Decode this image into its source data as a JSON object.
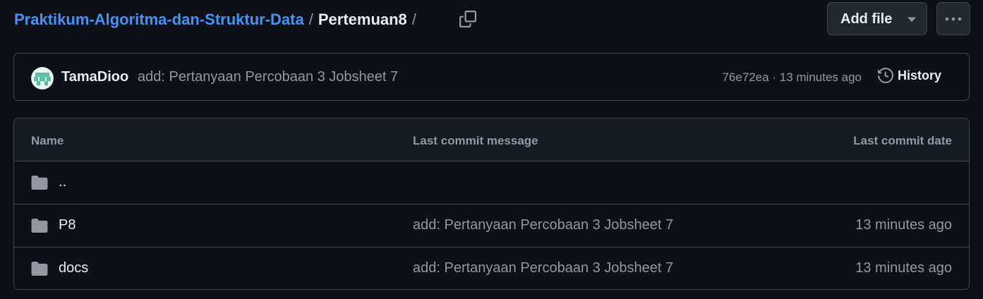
{
  "breadcrumb": {
    "repo": "Praktikum-Algoritma-dan-Struktur-Data",
    "separator": "/",
    "current": "Pertemuan8",
    "trailing_separator": "/"
  },
  "actions": {
    "add_file_label": "Add file",
    "more_label": "···"
  },
  "commit": {
    "author": "TamaDioo",
    "message": "add: Pertanyaan Percobaan 3 Jobsheet 7",
    "meta": "76e72ea · 13 minutes ago",
    "history_label": "History"
  },
  "table": {
    "columns": {
      "name": "Name",
      "message": "Last commit message",
      "date": "Last commit date"
    },
    "rows": [
      {
        "name": "..",
        "message": "",
        "date": ""
      },
      {
        "name": "P8",
        "message": "add: Pertanyaan Percobaan 3 Jobsheet 7",
        "date": "13 minutes ago"
      },
      {
        "name": "docs",
        "message": "add: Pertanyaan Percobaan 3 Jobsheet 7",
        "date": "13 minutes ago"
      }
    ]
  },
  "icons": {
    "copy": "copy-icon",
    "caret": "triangle-down-icon",
    "more": "kebab-horizontal-icon",
    "history": "history-icon",
    "folder": "folder-icon"
  },
  "colors": {
    "background": "#0d1117",
    "link": "#4493f8",
    "muted": "#9198a1",
    "border": "#3d444d",
    "folder": "#9198a1"
  }
}
